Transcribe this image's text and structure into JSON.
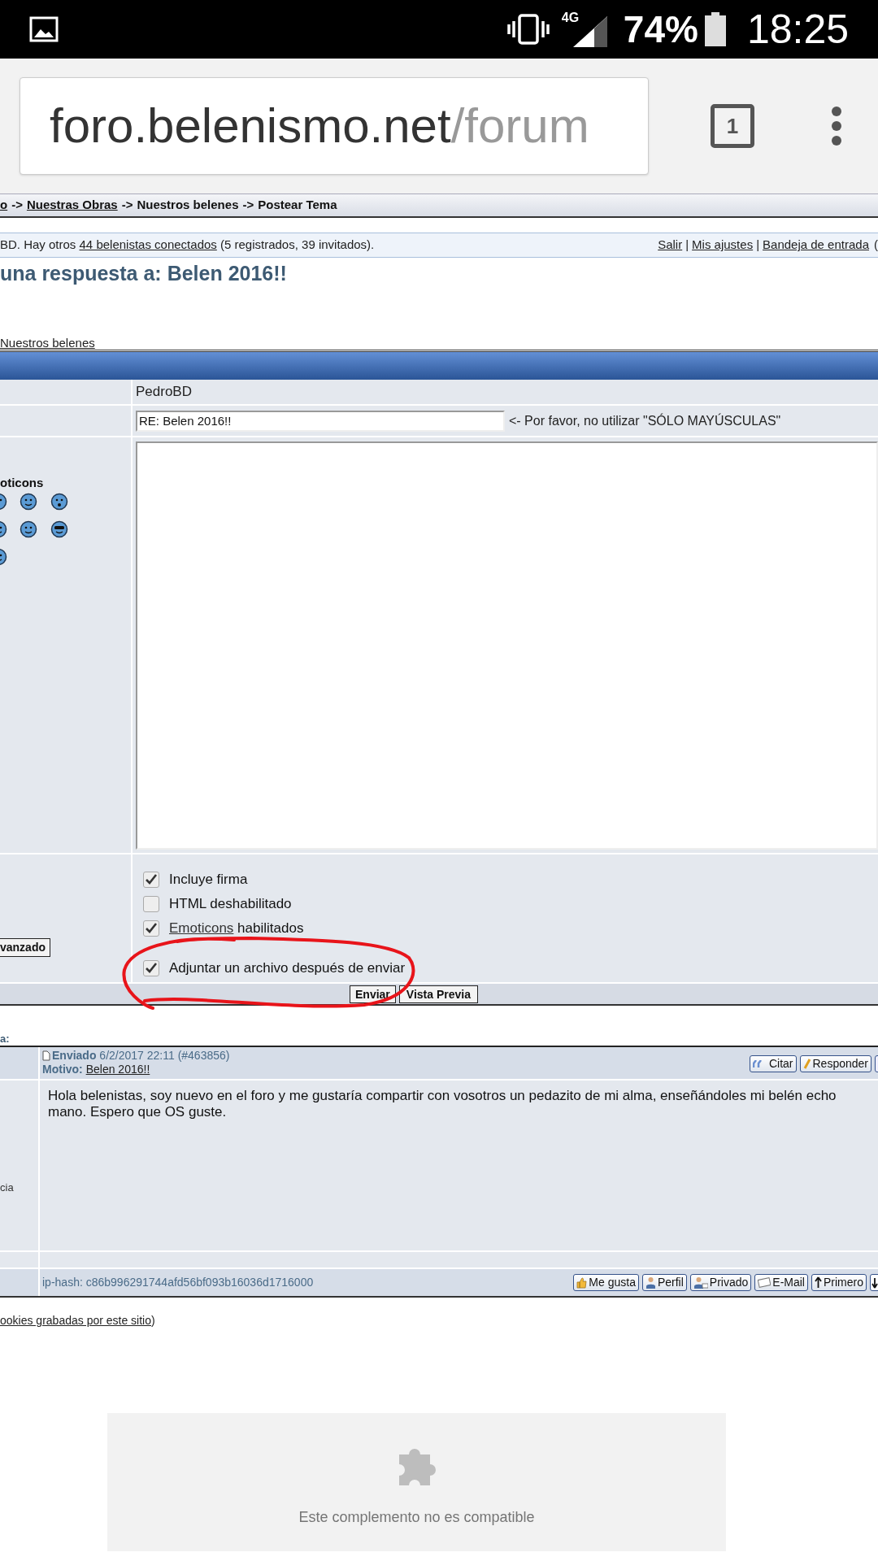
{
  "status_bar": {
    "network": "4G",
    "battery": "74%",
    "time": "18:25"
  },
  "browser": {
    "url_host": "foro.belenismo.net",
    "url_path": "/forum",
    "tab_count": "1"
  },
  "breadcrumb": {
    "separator": "->",
    "items": [
      {
        "label": "o",
        "link": true
      },
      {
        "label": "Nuestras Obras",
        "link": true
      },
      {
        "label": "Nuestros belenes",
        "link": false
      },
      {
        "label": "Postear Tema",
        "link": false
      }
    ]
  },
  "info_bar": {
    "text_before": "BD. Hay otros ",
    "link": "44 belenistas conectados",
    "text_after": " (5 registrados, 39 invitados).",
    "links": [
      "Salir",
      "Mis ajustes",
      "Bandeja de entrada"
    ],
    "separator": "|",
    "trailing": "("
  },
  "page_title": "una respuesta a: Belen 2016!!",
  "forum_link": "Nuestros belenes",
  "form": {
    "username": "PedroBD",
    "subject": "RE: Belen 2016!!",
    "subject_hint": "<- Por favor, no utilizar \"SÓLO MAYÚSCULAS\"",
    "emoticons_title": "oticons",
    "advanced_button": "vanzado",
    "options": [
      {
        "label": "Incluye firma",
        "checked": true
      },
      {
        "label": "HTML deshabilitado",
        "checked": false
      },
      {
        "link": "Emoticons",
        "label": "habilitados",
        "checked": true
      },
      {
        "label": "Adjuntar un archivo después de enviar",
        "checked": true
      }
    ],
    "buttons": [
      "Enviar",
      "Vista Previa"
    ]
  },
  "thread": {
    "heading": "a:",
    "post": {
      "posted_label": "Enviado",
      "date": "6/2/2017 22:11 (#463856)",
      "subject_label": "Motivo:",
      "subject": "Belen 2016!!",
      "actions": [
        "Citar",
        "Responder"
      ],
      "body_lines": [
        "Hola belenistas, soy nuevo en el foro y me gustaría compartir con vosotros un pedazito de mi alma, enseñándoles mi belén echo",
        "mano. Espero que OS guste."
      ],
      "author_cut": "cia",
      "ip_hash": "ip-hash: c86b996291744afd56bf093b16036d1716000",
      "footer_buttons": [
        "Me gusta",
        "Perfil",
        "Privado",
        "E-Mail",
        "Primero"
      ]
    }
  },
  "footer_note": {
    "link": "ookies grabadas por este sitio",
    "after": ")"
  },
  "plugin": {
    "message": "Este complemento no es compatible"
  }
}
